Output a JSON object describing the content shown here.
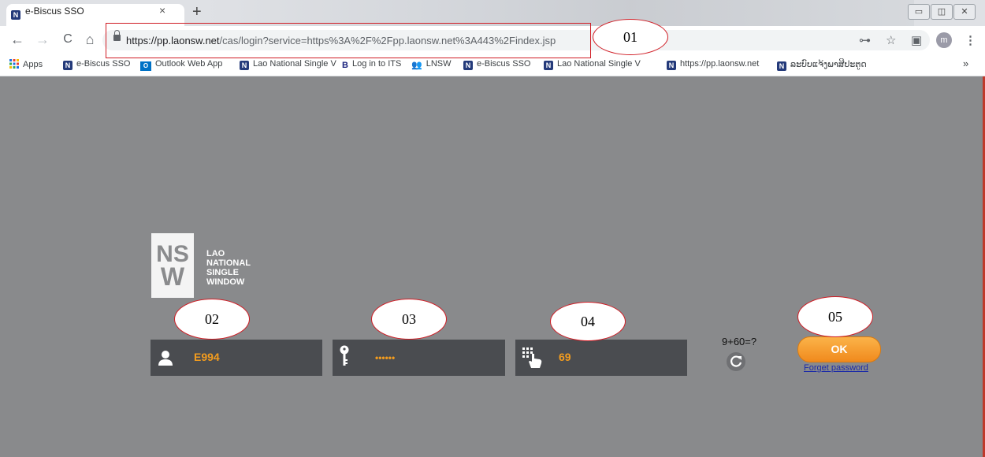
{
  "browser": {
    "tab": {
      "title": "e-Biscus SSO",
      "close": "×",
      "favicon": "N"
    },
    "new_tab": "+",
    "window_controls": {
      "minimize": "▭",
      "restore": "◫",
      "close": "✕"
    },
    "nav": {
      "back": "←",
      "forward": "→",
      "reload": "C",
      "home": "⌂"
    },
    "address": {
      "host": "https://pp.laonsw.net",
      "path": "/cas/login?service=https%3A%2F%2Fpp.laonsw.net%3A443%2Findex.jsp"
    },
    "toolbar_icons": {
      "key": "⊶",
      "star": "☆",
      "extension": "▣",
      "menu": "⋮"
    },
    "profile_initial": "m",
    "bookmarks": [
      {
        "label": "Apps",
        "icon": "apps-grid-icon"
      },
      {
        "label": "e-Biscus SSO",
        "icon": "nsw-favicon"
      },
      {
        "label": "Outlook Web App",
        "icon": "outlook-icon"
      },
      {
        "label": "Lao National Single V",
        "icon": "nsw-favicon"
      },
      {
        "label": "Log in to ITS",
        "icon": "its-icon"
      },
      {
        "label": "LNSW",
        "icon": "people-icon"
      },
      {
        "label": "e-Biscus SSO",
        "icon": "nsw-favicon"
      },
      {
        "label": "Lao National Single V",
        "icon": "nsw-favicon"
      },
      {
        "label": "https://pp.laonsw.net",
        "icon": "nsw-favicon"
      },
      {
        "label": "ລະບົບແຈ້ງພາສີປະຕູດ",
        "icon": "nsw-favicon"
      }
    ],
    "bookmarks_overflow": "»"
  },
  "login": {
    "logo": {
      "mark": "NSW",
      "lines": [
        "LAO",
        "NATIONAL",
        "SINGLE",
        "WINDOW"
      ]
    },
    "username_value": "E994",
    "password_value": "••••••",
    "captcha_answer": "69",
    "captcha_question": "9+60=?",
    "ok_label": "OK",
    "forget_password": "Forget password"
  },
  "annotations": [
    "01",
    "02",
    "03",
    "04",
    "05"
  ],
  "colors": {
    "page_bg": "#898a8c",
    "field_bg": "#4a4c50",
    "value": "#f39c1e",
    "ok_btn": "#f5a02f",
    "annotation": "#d01c24"
  }
}
